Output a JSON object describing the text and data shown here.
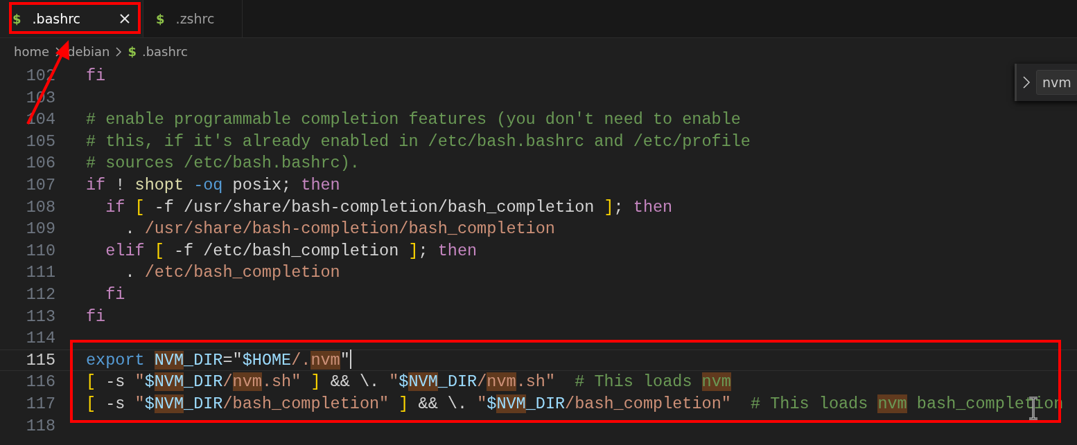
{
  "tabs": [
    {
      "icon": "$",
      "label": ".bashrc",
      "selected": true
    },
    {
      "icon": "$",
      "label": ".zshrc",
      "selected": false
    }
  ],
  "breadcrumbs": [
    {
      "label": "home"
    },
    {
      "label": "debian"
    },
    {
      "icon": "$",
      "label": ".bashrc"
    }
  ],
  "find_widget": {
    "expanded": false,
    "value": "nvm"
  },
  "lines": [
    {
      "number": "102",
      "current": false,
      "tokens": [
        {
          "text": "fi",
          "kind": "keyword"
        }
      ]
    },
    {
      "number": "103",
      "current": false
    },
    {
      "number": "104",
      "current": false,
      "tokens": [
        {
          "text": "# enable programmable completion features (you don't need to enable",
          "kind": "comment"
        }
      ]
    },
    {
      "number": "105",
      "current": false,
      "tokens": [
        {
          "text": "# this, if it's already enabled in /etc/bash.bashrc and /etc/profile",
          "kind": "comment"
        }
      ]
    },
    {
      "number": "106",
      "current": false,
      "tokens": [
        {
          "text": "# sources /etc/bash.bashrc).",
          "kind": "comment"
        }
      ]
    },
    {
      "number": "107",
      "current": false,
      "tokens": [
        {
          "text": "if",
          "kind": "keyword"
        },
        {
          "text": " ! ",
          "kind": "plain"
        },
        {
          "text": "shopt",
          "kind": "function"
        },
        {
          "text": " -oq",
          "kind": "option"
        },
        {
          "text": " posix; ",
          "kind": "plain"
        },
        {
          "text": "then",
          "kind": "keyword"
        }
      ]
    },
    {
      "number": "108",
      "current": false,
      "tokens": [
        {
          "text": "  if",
          "kind": "keyword"
        },
        {
          "text": " [",
          "kind": "bracket"
        },
        {
          "text": " -f /usr/share/bash-completion/bash_completion ",
          "kind": "plain"
        },
        {
          "text": "]",
          "kind": "bracket"
        },
        {
          "text": "; ",
          "kind": "plain"
        },
        {
          "text": "then",
          "kind": "keyword"
        }
      ]
    },
    {
      "number": "109",
      "current": false,
      "tokens": [
        {
          "text": "    . ",
          "kind": "plain"
        },
        {
          "text": "/usr/share/bash-completion/bash_completion",
          "kind": "string"
        }
      ]
    },
    {
      "number": "110",
      "current": false,
      "tokens": [
        {
          "text": "  elif",
          "kind": "keyword"
        },
        {
          "text": " [",
          "kind": "bracket"
        },
        {
          "text": " -f /etc/bash_completion ",
          "kind": "plain"
        },
        {
          "text": "]",
          "kind": "bracket"
        },
        {
          "text": "; ",
          "kind": "plain"
        },
        {
          "text": "then",
          "kind": "keyword"
        }
      ]
    },
    {
      "number": "111",
      "current": false,
      "tokens": [
        {
          "text": "    . ",
          "kind": "plain"
        },
        {
          "text": "/etc/bash_completion",
          "kind": "string"
        }
      ]
    },
    {
      "number": "112",
      "current": false,
      "tokens": [
        {
          "text": "  fi",
          "kind": "keyword"
        }
      ]
    },
    {
      "number": "113",
      "current": false,
      "tokens": [
        {
          "text": "fi",
          "kind": "keyword"
        }
      ]
    },
    {
      "number": "114",
      "current": false
    },
    {
      "number": "115",
      "current": true,
      "tokens": [
        {
          "text": "export ",
          "kind": "declaration"
        },
        {
          "text": "NVM",
          "kind": "variable",
          "match": true
        },
        {
          "text": "_DIR",
          "kind": "variable"
        },
        {
          "text": "=\"",
          "kind": "plain"
        },
        {
          "text": "$HOME",
          "kind": "variable"
        },
        {
          "text": "/.",
          "kind": "string"
        },
        {
          "text": "nvm",
          "kind": "string",
          "match": true
        },
        {
          "text": "\"",
          "kind": "plain"
        }
      ]
    },
    {
      "number": "116",
      "current": false,
      "tokens": [
        {
          "text": "[",
          "kind": "bracket"
        },
        {
          "text": " -s ",
          "kind": "plain"
        },
        {
          "text": "\"",
          "kind": "string"
        },
        {
          "text": "$",
          "kind": "variable"
        },
        {
          "text": "NVM",
          "kind": "variable",
          "match": true
        },
        {
          "text": "_DIR",
          "kind": "variable"
        },
        {
          "text": "/",
          "kind": "string"
        },
        {
          "text": "nvm",
          "kind": "string",
          "match": true
        },
        {
          "text": ".sh\" ",
          "kind": "string"
        },
        {
          "text": "]",
          "kind": "bracket"
        },
        {
          "text": " && \\. ",
          "kind": "plain"
        },
        {
          "text": "\"",
          "kind": "string"
        },
        {
          "text": "$",
          "kind": "variable"
        },
        {
          "text": "NVM",
          "kind": "variable",
          "match": true
        },
        {
          "text": "_DIR",
          "kind": "variable"
        },
        {
          "text": "/",
          "kind": "string"
        },
        {
          "text": "nvm",
          "kind": "string",
          "match": true
        },
        {
          "text": ".sh\"",
          "kind": "string"
        },
        {
          "text": "  # This loads ",
          "kind": "comment"
        },
        {
          "text": "nvm",
          "kind": "comment",
          "match": true
        }
      ]
    },
    {
      "number": "117",
      "current": false,
      "tokens": [
        {
          "text": "[",
          "kind": "bracket"
        },
        {
          "text": " -s ",
          "kind": "plain"
        },
        {
          "text": "\"",
          "kind": "string"
        },
        {
          "text": "$",
          "kind": "variable"
        },
        {
          "text": "NVM",
          "kind": "variable",
          "match": true
        },
        {
          "text": "_DIR",
          "kind": "variable"
        },
        {
          "text": "/bash_completion\" ",
          "kind": "string"
        },
        {
          "text": "]",
          "kind": "bracket"
        },
        {
          "text": " && \\. ",
          "kind": "plain"
        },
        {
          "text": "\"",
          "kind": "string"
        },
        {
          "text": "$",
          "kind": "variable"
        },
        {
          "text": "NVM",
          "kind": "variable",
          "match": true
        },
        {
          "text": "_DIR",
          "kind": "variable"
        },
        {
          "text": "/bash_completion\"",
          "kind": "string"
        },
        {
          "text": "  # This loads ",
          "kind": "comment"
        },
        {
          "text": "nvm",
          "kind": "comment",
          "match": true
        },
        {
          "text": " bash_completion",
          "kind": "comment"
        }
      ]
    },
    {
      "number": "118",
      "current": false
    }
  ]
}
